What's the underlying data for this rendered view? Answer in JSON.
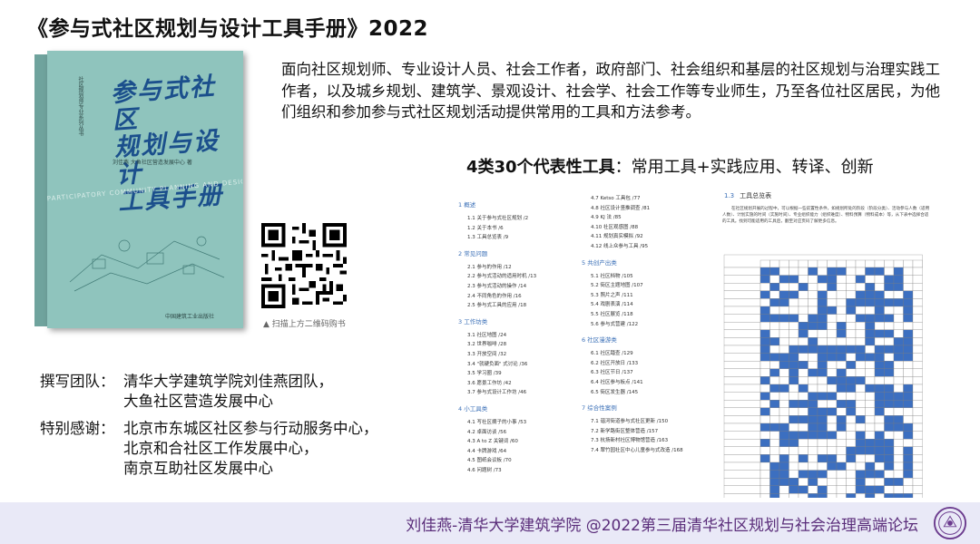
{
  "title": "《参与式社区规划与设计工具手册》2022",
  "book": {
    "title_lines": [
      "参与式社区",
      "规划与设计",
      "工具手册"
    ],
    "series": "社区规划师专业系列丛书",
    "authors": "刘佳燕   大鱼社区营造发展中心   著",
    "band": "PARTICIPATORY COMMUNITY PLANNING AND DESIGN TOOLKIT",
    "publisher": "中国建筑工业出版社"
  },
  "qr_caption": "扫描上方二维码购书",
  "description": "面向社区规划师、专业设计人员、社会工作者，政府部门、社会组织和基层的社区规划与治理实践工作者，以及城乡规划、建筑学、景观设计、社会学、社会工作等专业师生，乃至各位社区居民，为他们组织和参加参与式社区规划活动提供常用的工具和方法参考。",
  "subheading": {
    "bold": "4类30个代表性工具",
    "rest": "：常用工具+实践应用、转译、创新"
  },
  "team": [
    {
      "label": "撰写团队：",
      "values": [
        "清华大学建筑学院刘佳燕团队，",
        "大鱼社区营造发展中心"
      ]
    },
    {
      "label": "特别感谢：",
      "values": [
        "北京市东城区社区参与行动服务中心，",
        "北京和合社区工作发展中心，",
        "南京互助社区发展中心"
      ]
    }
  ],
  "toc": {
    "col1": [
      {
        "section": "1  概述",
        "items": [
          "1.1  关于参与式社区规划 /2",
          "1.2  关于本书 /6",
          "1.3  工具总览表 /9"
        ]
      },
      {
        "section": "2  常见问题",
        "items": [
          "2.1  参与的作用 /12",
          "2.2  参与式活动的适用时机 /13",
          "2.3  参与式活动的操作 /14",
          "2.4  不同角色的作用 /16",
          "2.5  参与式工具的应用 /18"
        ]
      },
      {
        "section": "3  工作坊类",
        "items": [
          "3.1  社区地图 /24",
          "3.2  世界咖啡 /28",
          "3.3  开放空间 /32",
          "3.4  \"就硬负面\" 式讨论 /36",
          "3.5  学习圈 /39",
          "3.6  愿景工作坊 /42",
          "3.7  参与式设计工作坊 /46"
        ]
      },
      {
        "section": "4  小工具类",
        "items": [
          "4.1  写社区摘子的小事 /53",
          "4.2  卓面访谈 /56",
          "4.3  A to Z 关键词 /60",
          "4.4  卡牌游戏 /64",
          "4.5  图纸会议板 /70",
          "4.6  问题树 /73"
        ]
      }
    ],
    "col2": [
      {
        "section": "",
        "items": [
          "4.7  Ketso 工具包 /77",
          "4.8  社区设计竖推调查 /81",
          "4.9  KJ 法 /85",
          "4.10  社区观感图 /88",
          "4.11  规划真实模拟 /92",
          "4.12  线上众参与工具 /95"
        ]
      },
      {
        "section": "5  共创产出类",
        "items": [
          "5.1  社区档物 /105",
          "5.2  街区主题地图 /107",
          "5.3  照片之声 /111",
          "5.4  戏剧表演 /114",
          "5.5  社区展览 /118",
          "5.6  参与式营建 /122"
        ]
      },
      {
        "section": "6  社区漫游类",
        "items": [
          "6.1  社区踏查 /129",
          "6.2  社区开放日 /133",
          "6.3  社区节日 /137",
          "6.4  社区参与板点 /141",
          "6.5  街区发生器 /145"
        ]
      },
      {
        "section": "7  综合性案例",
        "items": [
          "7.1  谐河街道参与式社区更新 /150",
          "7.2  新学路街区整体营造 /157",
          "7.3  杭扬新村社区博物馆营造 /163",
          "7.4  翠竹园社区中心儿童参与式改造 /168"
        ]
      }
    ]
  },
  "matrix_page": {
    "heading_num": "1.3",
    "heading": "工具总览表",
    "text": "在社区规划开展的过程中，可以根据一些前置性条件，如规划所处的阶段（阶段分类）、活动参与人数（适用人数）、计划实施的时间（实施时间）、专业组织能力（组织难度）、物料预算（物料成本）等，从下表中选择合适的工具。找到可能适用的工具后，翻至对应页码了解更多信息。"
  },
  "footer": "刘佳燕-清华大学建筑学院   @2022第三届清华社区规划与社会治理高端论坛",
  "colors": {
    "accent": "#3a6fb7",
    "footer_text": "#5a2d7a",
    "footer_bg": "#e9e9f7",
    "book": "#8fc4bd"
  }
}
